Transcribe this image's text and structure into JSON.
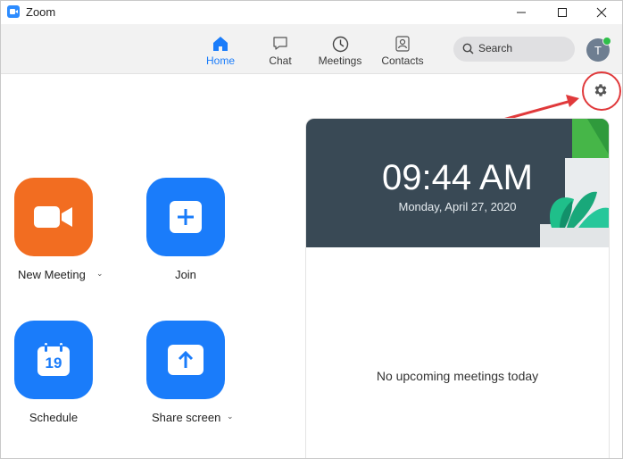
{
  "window": {
    "title": "Zoom"
  },
  "nav": {
    "tabs": [
      {
        "label": "Home",
        "icon": "home-icon",
        "active": true
      },
      {
        "label": "Chat",
        "icon": "chat-icon",
        "active": false
      },
      {
        "label": "Meetings",
        "icon": "clock-icon",
        "active": false
      },
      {
        "label": "Contacts",
        "icon": "contacts-icon",
        "active": false
      }
    ],
    "search_label": "Search",
    "avatar_initial": "T"
  },
  "actions": {
    "new_meeting": "New Meeting",
    "join": "Join",
    "schedule": "Schedule",
    "schedule_day": "19",
    "share_screen": "Share screen"
  },
  "banner": {
    "time": "09:44 AM",
    "date": "Monday, April 27, 2020"
  },
  "meetings": {
    "empty_text": "No upcoming meetings today"
  },
  "colors": {
    "accent": "#1a7cfa",
    "new_meeting": "#f26d21",
    "banner_bg": "#394955",
    "highlight": "#e0393b"
  }
}
